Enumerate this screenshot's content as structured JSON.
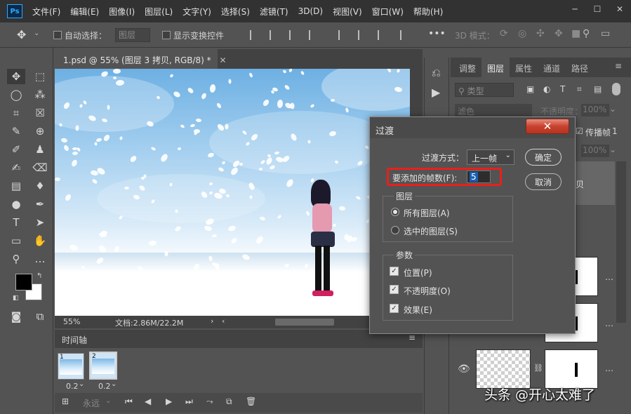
{
  "app": {
    "logo": "Ps"
  },
  "menu": [
    "文件(F)",
    "编辑(E)",
    "图像(I)",
    "图层(L)",
    "文字(Y)",
    "选择(S)",
    "滤镜(T)",
    "3D(D)",
    "视图(V)",
    "窗口(W)",
    "帮助(H)"
  ],
  "options": {
    "auto_select_label": "自动选择：",
    "auto_select_value": "图层",
    "show_transform_label": "显示变换控件",
    "mode_3d_label": "3D 模式："
  },
  "document": {
    "tab_title": "1.psd @ 55% (图层 3 拷贝, RGB/8) *",
    "zoom": "55%",
    "doc_info": "文档:2.86M/22.2M"
  },
  "timeline": {
    "title": "时间轴",
    "frames": [
      {
        "number": "1",
        "delay": "0.2"
      },
      {
        "number": "2",
        "delay": "0.2"
      }
    ],
    "loop": "永远"
  },
  "panels": {
    "tabs": [
      "调整",
      "图层",
      "属性",
      "通道",
      "路径"
    ],
    "kind_filter": "类型",
    "blend_mode": "滤色",
    "opacity_label": "不透明度：",
    "opacity_value": "100%",
    "fill_value": "100%",
    "propagate_label": "传播帧",
    "propagate_value": "1",
    "layer_name_partial": "贝"
  },
  "dialog": {
    "title": "过渡",
    "tween_with_label": "过渡方式：",
    "tween_with_value": "上一帧",
    "frames_to_add_label": "要添加的帧数(F):",
    "frames_to_add_value": "5",
    "ok_label": "确定",
    "cancel_label": "取消",
    "layers_group_title": "图层",
    "all_layers_label": "所有图层(A)",
    "selected_layers_label": "选中的图层(S)",
    "params_group_title": "参数",
    "position_label": "位置(P)",
    "opacity_label": "不透明度(O)",
    "effects_label": "效果(E)",
    "highlight_color": "#e8201c"
  },
  "watermark": "头条 @开心太难了"
}
